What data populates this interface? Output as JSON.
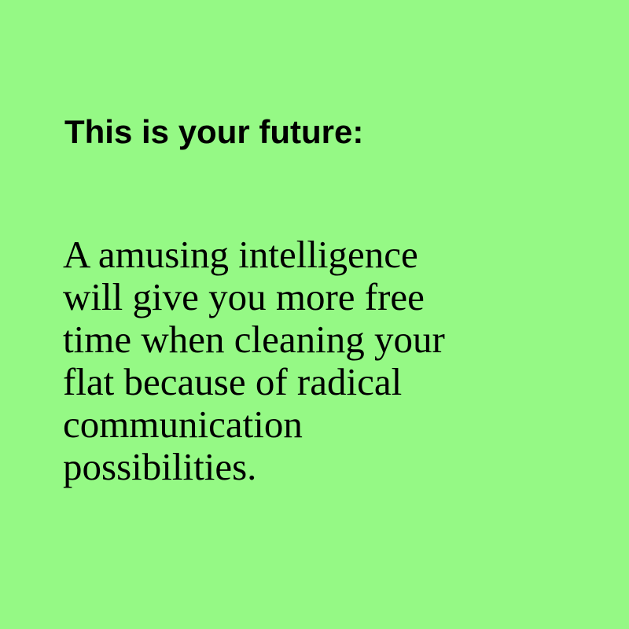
{
  "heading": "This is your future:",
  "message": {
    "lines": [
      "A amusing intelligence",
      "will give you more free",
      "time when cleaning your",
      "flat because of radical",
      "communication",
      "possibilities."
    ]
  },
  "colors": {
    "background": "#95f985",
    "text": "#000000"
  }
}
